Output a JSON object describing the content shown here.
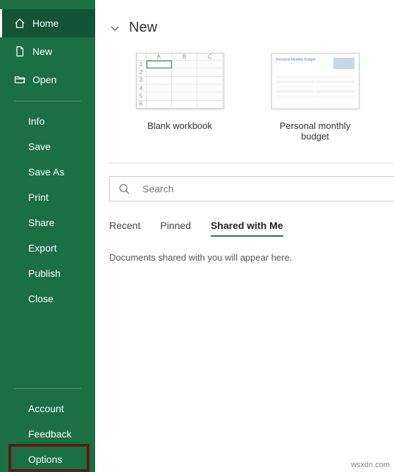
{
  "sidebar": {
    "primary": [
      {
        "label": "Home"
      },
      {
        "label": "New"
      },
      {
        "label": "Open"
      }
    ],
    "file": [
      {
        "label": "Info"
      },
      {
        "label": "Save"
      },
      {
        "label": "Save As"
      },
      {
        "label": "Print"
      },
      {
        "label": "Share"
      },
      {
        "label": "Export"
      },
      {
        "label": "Publish"
      },
      {
        "label": "Close"
      }
    ],
    "bottom": [
      {
        "label": "Account"
      },
      {
        "label": "Feedback"
      },
      {
        "label": "Options"
      }
    ]
  },
  "main": {
    "section_title": "New",
    "templates": [
      {
        "label": "Blank workbook"
      },
      {
        "label": "Personal monthly budget"
      }
    ],
    "search_placeholder": "Search",
    "tabs": [
      {
        "label": "Recent"
      },
      {
        "label": "Pinned"
      },
      {
        "label": "Shared with Me"
      }
    ],
    "empty_message": "Documents shared with you will appear here."
  },
  "watermark": "wsxdn.com",
  "thumb": {
    "cols": [
      "A",
      "B",
      "C"
    ],
    "rows": [
      "1",
      "2",
      "3",
      "4",
      "5",
      "6"
    ],
    "budget_title": "Personal Monthly Budget"
  }
}
